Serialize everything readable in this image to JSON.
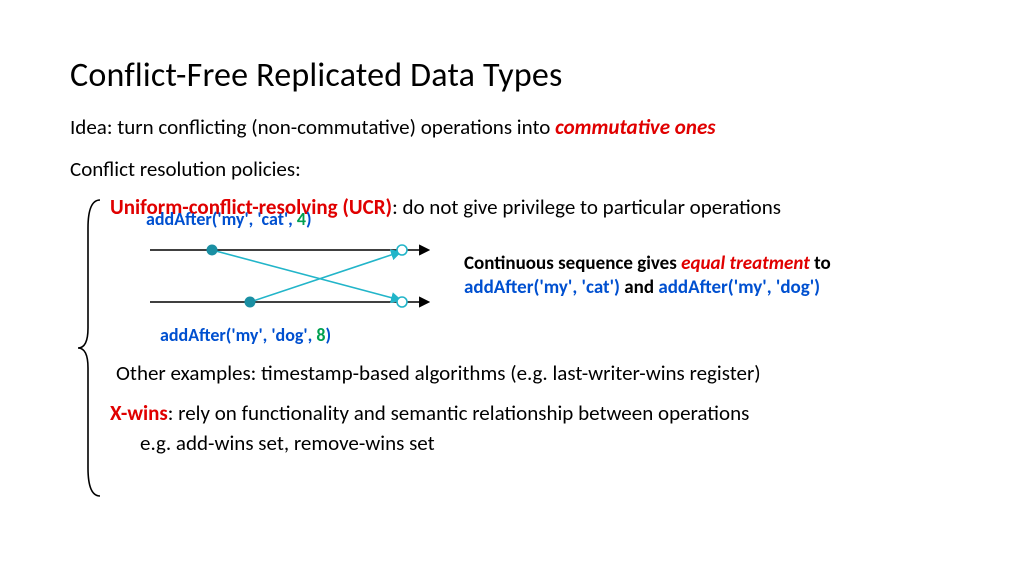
{
  "title": "Conflict-Free Replicated Data Types",
  "idea_prefix": "Idea: turn conflicting (non-commutative) operations into ",
  "idea_emph": "commutative ones",
  "policies_label": "Conflict resolution policies:",
  "ucr_label": "Uniform-conflict-resolving (UCR)",
  "ucr_rest": ":  do not give privilege to particular operations",
  "diag_top_pre": "addAfter('my', 'cat', ",
  "diag_top_num": "4",
  "diag_top_post": ")",
  "diag_bot_pre": "addAfter('my', 'dog', ",
  "diag_bot_num": "8",
  "diag_bot_post": ")",
  "caption_a": "Continuous sequence gives ",
  "caption_emph": "equal treatment",
  "caption_b": " to ",
  "caption_c1": "addAfter('my', 'cat')",
  "caption_and": " and ",
  "caption_c2": "addAfter('my', 'dog')",
  "other_examples": "Other examples: timestamp-based algorithms (e.g. last-writer-wins register)",
  "xwins_label": "X-wins",
  "xwins_rest": ":  rely on functionality and semantic relationship between operations",
  "xwins_eg": "e.g. add-wins set, remove-wins set"
}
